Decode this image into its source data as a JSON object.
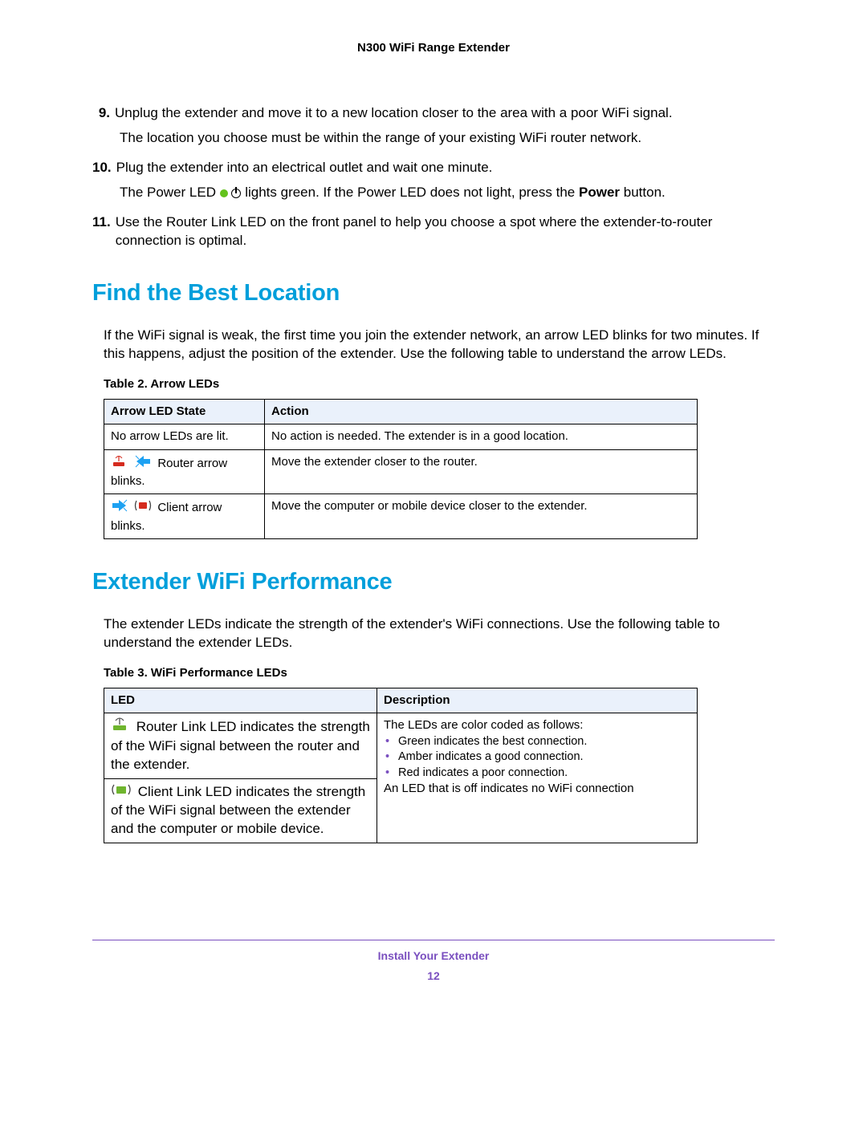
{
  "header": {
    "title": "N300 WiFi Range Extender"
  },
  "steps": [
    {
      "num": "9.",
      "text": "Unplug the extender and move it to a new location closer to the area with a poor WiFi signal.",
      "sub": "The location you choose must be within the range of your existing WiFi router network."
    },
    {
      "num": "10.",
      "text": "Plug the extender into an electrical outlet and wait one minute.",
      "sub_pre": "The Power LED ",
      "sub_mid": " lights green. If the Power LED does not light, press the ",
      "sub_bold": "Power",
      "sub_post": " button."
    },
    {
      "num": "11.",
      "text": "Use the Router Link LED on the front panel to help you choose a spot where the extender-to-router connection is optimal."
    }
  ],
  "h_find": "Find the Best Location",
  "find_intro": "If the WiFi signal is weak, the first time you join the extender network, an arrow LED blinks for two minutes. If this happens, adjust the position of the extender. Use the following table to understand the arrow LEDs.",
  "table2": {
    "caption": "Table 2.  Arrow LEDs",
    "h0": "Arrow LED State",
    "h1": "Action",
    "rows": [
      {
        "state": "No arrow LEDs are lit.",
        "action": "No action is needed. The extender is in a good location."
      },
      {
        "state": "Router arrow blinks.",
        "action": "Move the extender closer to the router."
      },
      {
        "state": "Client arrow blinks.",
        "action": "Move the computer or mobile device closer to the extender."
      }
    ]
  },
  "h_perf": "Extender WiFi Performance",
  "perf_intro": "The extender LEDs indicate the strength of the extender's WiFi connections. Use the following table to understand the extender LEDs.",
  "table3": {
    "caption": "Table 3.  WiFi Performance LEDs",
    "h0": "LED",
    "h1": "Description",
    "led_router": "Router Link LED indicates the strength of the WiFi signal between the router and the extender.",
    "led_client": "Client Link LED indicates the strength of the WiFi signal between the extender and the computer or mobile device.",
    "desc_intro": "The LEDs are color coded as follows:",
    "desc_items": [
      "Green indicates the best connection.",
      "Amber indicates a good connection.",
      "Red indicates a poor connection."
    ],
    "desc_off": "An LED that is off indicates no WiFi connection"
  },
  "footer": {
    "section": "Install Your Extender",
    "page": "12"
  }
}
